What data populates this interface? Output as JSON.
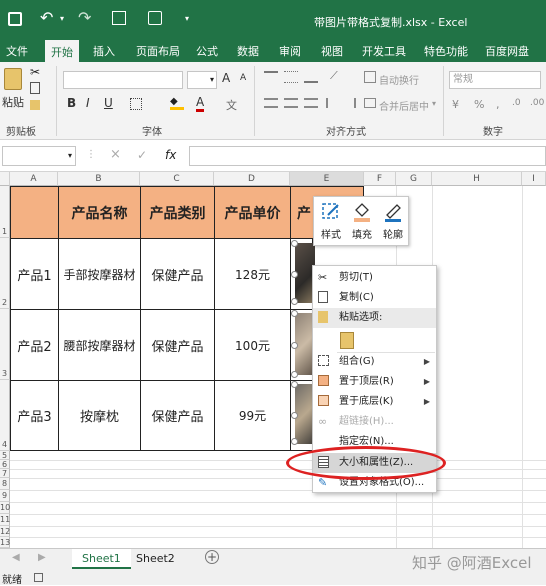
{
  "titlebar": {
    "title": "带图片带格式复制.xlsx - Excel"
  },
  "ribbon_tabs": [
    {
      "label": "文件"
    },
    {
      "label": "开始"
    },
    {
      "label": "插入"
    },
    {
      "label": "页面布局"
    },
    {
      "label": "公式"
    },
    {
      "label": "数据"
    },
    {
      "label": "审阅"
    },
    {
      "label": "视图"
    },
    {
      "label": "开发工具"
    },
    {
      "label": "特色功能"
    },
    {
      "label": "百度网盘"
    }
  ],
  "ribbon": {
    "paste_label": "粘贴",
    "clipboard_group": "剪贴板",
    "font_group": "字体",
    "align_group": "对齐方式",
    "number_group": "数字",
    "bold": "B",
    "italic": "I",
    "underline": "U",
    "font_grow": "A",
    "font_shrink": "A",
    "font_color": "A",
    "wrap_text": "自动换行",
    "merge_center": "合并后居中",
    "number_format": "常规"
  },
  "formula_bar": {
    "cancel": "×",
    "confirm": "✓",
    "fx": "fx"
  },
  "columns": [
    "A",
    "B",
    "C",
    "D",
    "E",
    "F",
    "G",
    "H",
    "I"
  ],
  "rows": [
    "1",
    "2",
    "3",
    "4",
    "5",
    "6",
    "7",
    "8",
    "9",
    "10",
    "11",
    "12",
    "13"
  ],
  "table": {
    "headers": [
      "产品名称",
      "产品类别",
      "产品单价",
      "产"
    ],
    "rows": [
      {
        "label": "产品1",
        "name": "手部按摩器材",
        "category": "保健产品",
        "price": "128元"
      },
      {
        "label": "产品2",
        "name": "腰部按摩器材",
        "category": "保健产品",
        "price": "100元"
      },
      {
        "label": "产品3",
        "name": "按摩枕",
        "category": "保健产品",
        "price": "99元"
      }
    ]
  },
  "mini_toolbar": {
    "style": "样式",
    "fill": "填充",
    "outline": "轮廓"
  },
  "context_menu": {
    "cut": "剪切(T)",
    "copy": "复制(C)",
    "paste_options": "粘贴选项:",
    "group": "组合(G)",
    "bring_to_front": "置于顶层(R)",
    "send_to_back": "置于底层(K)",
    "hyperlink": "超链接(H)...",
    "assign_macro": "指定宏(N)...",
    "size_properties": "大小和属性(Z)...",
    "format_object": "设置对象格式(O)..."
  },
  "sheet_tabs": [
    {
      "label": "Sheet1"
    },
    {
      "label": "Sheet2"
    }
  ],
  "add_sheet": "+",
  "status": {
    "ready": "就绪"
  },
  "watermark": "知乎 @阿酒Excel",
  "colors": {
    "excel_green": "#217346",
    "header_fill": "#f4b183",
    "highlight_ring": "#d22"
  }
}
